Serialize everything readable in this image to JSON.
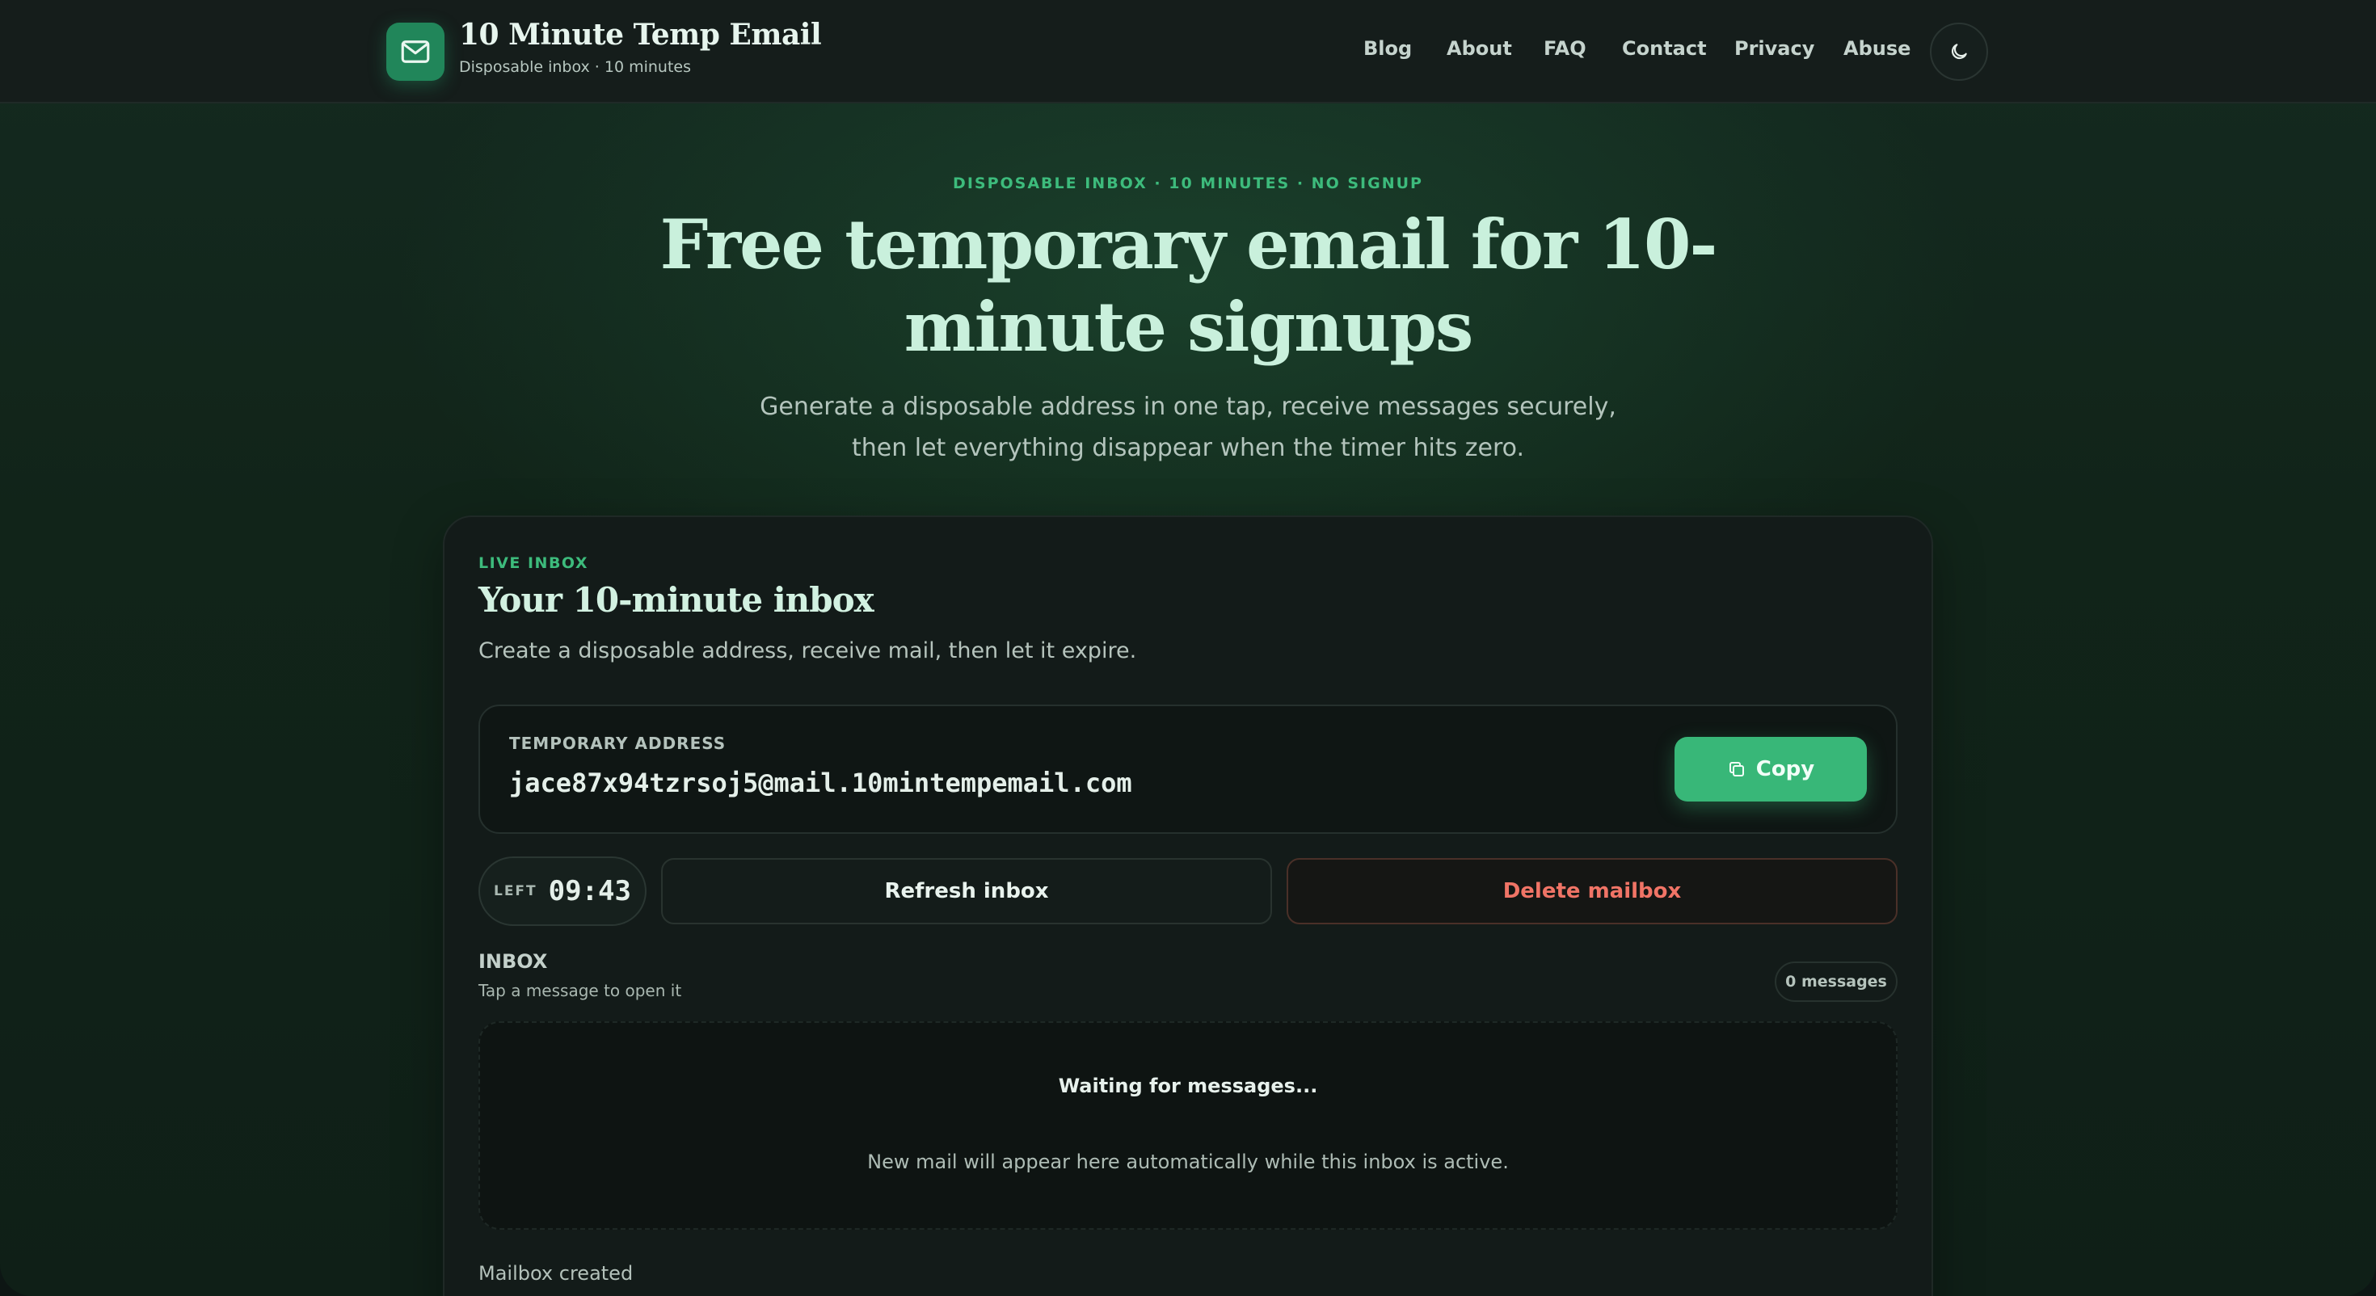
{
  "header": {
    "brand_title": "10 Minute Temp Email",
    "brand_subtitle": "Disposable inbox · 10 minutes",
    "logo_icon": "mail-icon",
    "nav": [
      "Blog",
      "About",
      "FAQ",
      "Contact",
      "Privacy",
      "Abuse"
    ],
    "theme_toggle_icon": "moon-icon"
  },
  "hero": {
    "eyebrow": "DISPOSABLE INBOX · 10 MINUTES · NO SIGNUP",
    "title": "Free temporary email for 10-minute signups",
    "subtitle": "Generate a disposable address in one tap, receive messages securely, then let everything disappear when the timer hits zero."
  },
  "inbox_card": {
    "eyebrow": "LIVE INBOX",
    "title": "Your 10-minute inbox",
    "subtitle": "Create a disposable address, receive mail, then let it expire.",
    "address_label": "TEMPORARY ADDRESS",
    "address": "jace87x94tzrsoj5@mail.10mintempemail.com",
    "copy_label": "Copy",
    "copy_icon": "copy-icon",
    "timer_label": "LEFT",
    "timer_value": "09:43",
    "refresh_label": "Refresh inbox",
    "delete_label": "Delete mailbox",
    "inbox_label": "INBOX",
    "inbox_hint": "Tap a message to open it",
    "message_count": "0 messages",
    "empty_title": "Waiting for messages...",
    "empty_subtitle": "New mail will appear here automatically while this inbox is active.",
    "status": "Mailbox created"
  },
  "colors": {
    "accent": "#38b778",
    "accent_text": "#3dbb7c",
    "danger": "#f07466",
    "background": "#112419"
  }
}
